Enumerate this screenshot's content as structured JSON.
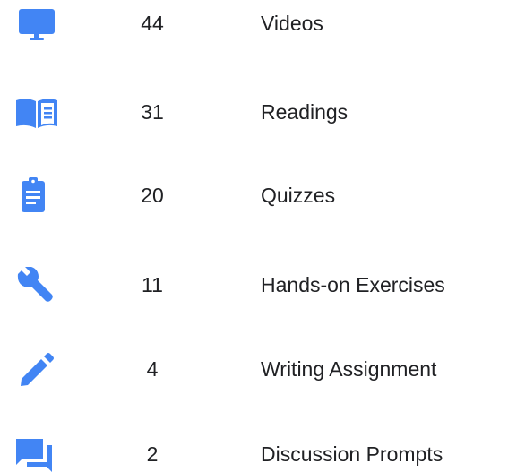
{
  "colors": {
    "icon": "#4285f4",
    "text": "#202124",
    "background": "#ffffff"
  },
  "items": [
    {
      "icon": "monitor-icon",
      "count": "44",
      "label": "Videos"
    },
    {
      "icon": "book-icon",
      "count": "31",
      "label": "Readings"
    },
    {
      "icon": "clipboard-icon",
      "count": "20",
      "label": "Quizzes"
    },
    {
      "icon": "wrench-icon",
      "count": "11",
      "label": "Hands-on Exercises"
    },
    {
      "icon": "pencil-icon",
      "count": "4",
      "label": "Writing Assignment"
    },
    {
      "icon": "forum-icon",
      "count": "2",
      "label": "Discussion Prompts"
    }
  ]
}
